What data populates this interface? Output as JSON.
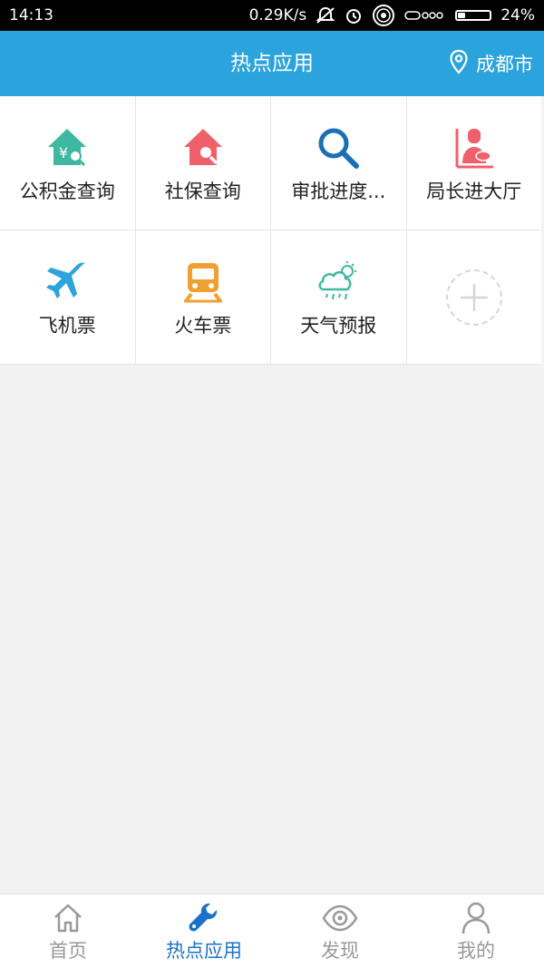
{
  "status_bar": {
    "time": "14:13",
    "net_speed": "0.29K/s",
    "battery": "24%",
    "battery_level": 0.24
  },
  "header": {
    "title": "热点应用",
    "location": "成都市",
    "color": "#2ba3dc"
  },
  "apps": [
    {
      "label": "公积金查询",
      "icon": "house-yuan-icon",
      "color": "#3fb8a0"
    },
    {
      "label": "社保查询",
      "icon": "house-search-icon",
      "color": "#f0606a"
    },
    {
      "label": "审批进度...",
      "icon": "magnifier-icon",
      "color": "#1a6fb5"
    },
    {
      "label": "局长进大厅",
      "icon": "official-person-icon",
      "color": "#f0606a"
    },
    {
      "label": "飞机票",
      "icon": "airplane-icon",
      "color": "#2ba3dc"
    },
    {
      "label": "火车票",
      "icon": "train-icon",
      "color": "#f0a030"
    },
    {
      "label": "天气预报",
      "icon": "cloud-rain-icon",
      "color": "#3fb8a0"
    }
  ],
  "add_tile": {
    "icon": "plus-icon"
  },
  "bottom_nav": [
    {
      "label": "首页",
      "icon": "home-icon",
      "active": false
    },
    {
      "label": "热点应用",
      "icon": "wrench-icon",
      "active": true
    },
    {
      "label": "发现",
      "icon": "eye-icon",
      "active": false
    },
    {
      "label": "我的",
      "icon": "person-icon",
      "active": false
    }
  ],
  "colors": {
    "accent": "#2ba3dc",
    "active_nav": "#1a72c8",
    "inactive_nav": "#999999"
  }
}
